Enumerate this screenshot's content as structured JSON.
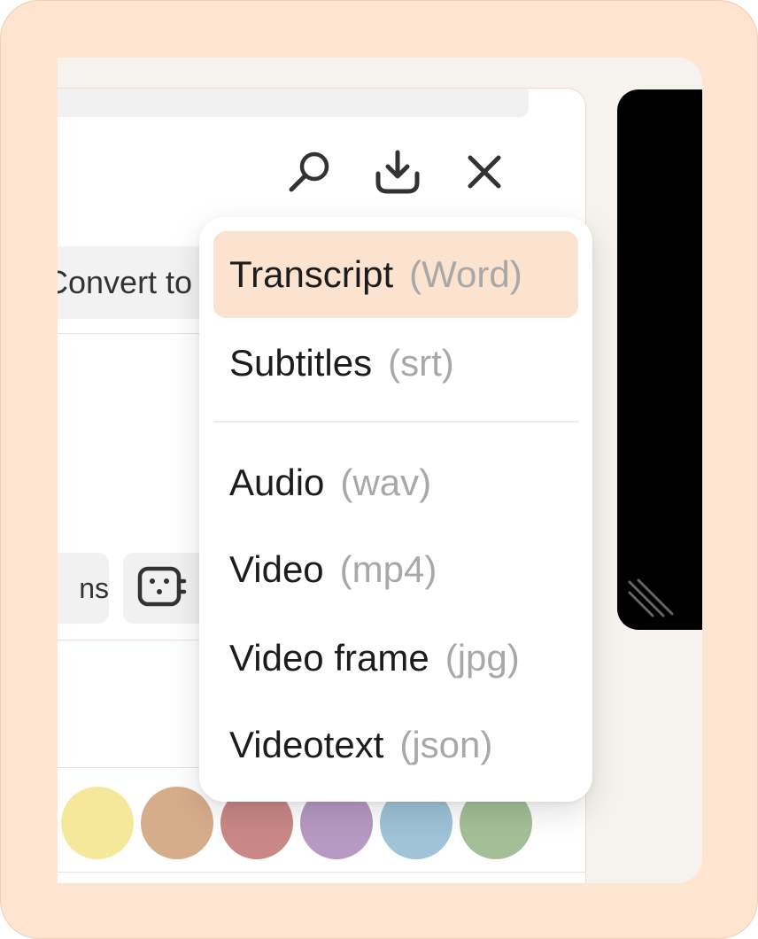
{
  "toolbar": {
    "convert_label": "Convert to",
    "chip_label": "ns"
  },
  "download_menu": {
    "items": [
      {
        "label": "Transcript",
        "format": "(Word)",
        "selected": true
      },
      {
        "label": "Subtitles",
        "format": "(srt)",
        "selected": false
      },
      {
        "label": "Audio",
        "format": "(wav)",
        "selected": false
      },
      {
        "label": "Video",
        "format": "(mp4)",
        "selected": false
      },
      {
        "label": "Video frame",
        "format": "(jpg)",
        "selected": false
      },
      {
        "label": "Videotext",
        "format": "(json)",
        "selected": false
      }
    ]
  },
  "swatches": [
    "#f6e89b",
    "#d6ad8b",
    "#c98885",
    "#b899c3",
    "#9fc3d8",
    "#a4bf98"
  ],
  "colors": {
    "frame": "#fee5d2",
    "selected_item": "#fbe3d0",
    "format_text": "#a8a8a8"
  }
}
